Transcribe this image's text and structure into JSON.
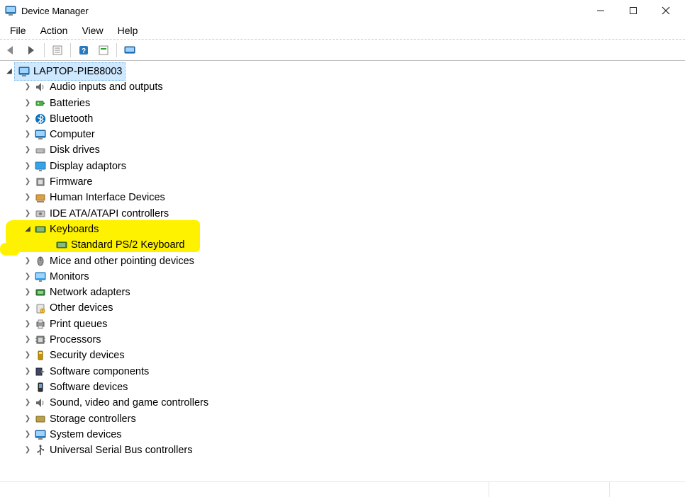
{
  "window": {
    "title": "Device Manager"
  },
  "menus": {
    "file": "File",
    "action": "Action",
    "view": "View",
    "help": "Help"
  },
  "tree": {
    "root": "LAPTOP-PIE88003",
    "items": [
      {
        "label": "Audio inputs and outputs",
        "icon": "speaker",
        "expanded": false
      },
      {
        "label": "Batteries",
        "icon": "battery",
        "expanded": false
      },
      {
        "label": "Bluetooth",
        "icon": "bluetooth",
        "expanded": false
      },
      {
        "label": "Computer",
        "icon": "computer",
        "expanded": false
      },
      {
        "label": "Disk drives",
        "icon": "disk",
        "expanded": false
      },
      {
        "label": "Display adaptors",
        "icon": "display",
        "expanded": false
      },
      {
        "label": "Firmware",
        "icon": "firmware",
        "expanded": false
      },
      {
        "label": "Human Interface Devices",
        "icon": "hid",
        "expanded": false
      },
      {
        "label": "IDE ATA/ATAPI controllers",
        "icon": "ide",
        "expanded": false
      },
      {
        "label": "Keyboards",
        "icon": "keyboard",
        "expanded": true,
        "children": [
          {
            "label": "Standard PS/2 Keyboard",
            "icon": "keyboard"
          }
        ]
      },
      {
        "label": "Mice and other pointing devices",
        "icon": "mouse",
        "expanded": false
      },
      {
        "label": "Monitors",
        "icon": "monitor",
        "expanded": false
      },
      {
        "label": "Network adapters",
        "icon": "network",
        "expanded": false
      },
      {
        "label": "Other devices",
        "icon": "other",
        "expanded": false
      },
      {
        "label": "Print queues",
        "icon": "printer",
        "expanded": false
      },
      {
        "label": "Processors",
        "icon": "cpu",
        "expanded": false
      },
      {
        "label": "Security devices",
        "icon": "security",
        "expanded": false
      },
      {
        "label": "Software components",
        "icon": "swcomp",
        "expanded": false
      },
      {
        "label": "Software devices",
        "icon": "swdev",
        "expanded": false
      },
      {
        "label": "Sound, video and game controllers",
        "icon": "speaker",
        "expanded": false
      },
      {
        "label": "Storage controllers",
        "icon": "storage",
        "expanded": false
      },
      {
        "label": "System devices",
        "icon": "system",
        "expanded": false
      },
      {
        "label": "Universal Serial Bus controllers",
        "icon": "usb",
        "expanded": false
      }
    ]
  }
}
